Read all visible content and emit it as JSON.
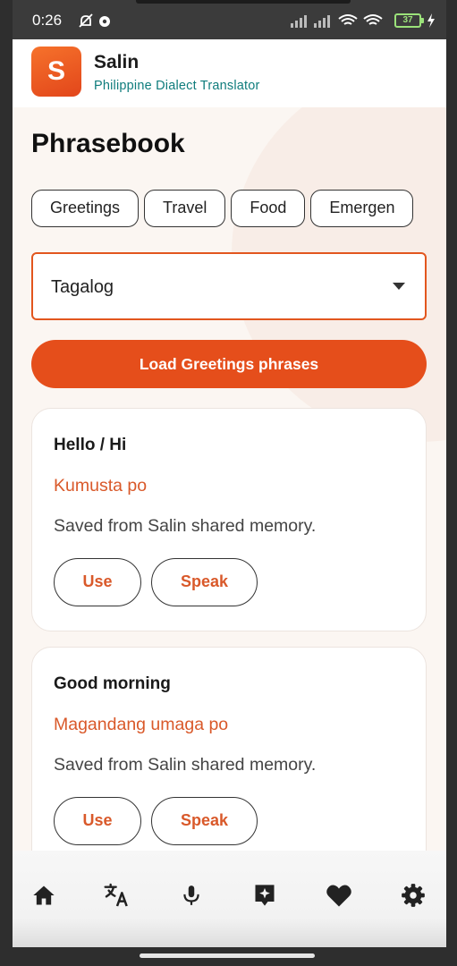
{
  "status_bar": {
    "time": "0:26",
    "battery": "37"
  },
  "app": {
    "name": "Salin",
    "tagline": "Philippine Dialect Translator",
    "logo_letter": "S"
  },
  "page": {
    "title": "Phrasebook"
  },
  "categories": [
    "Greetings",
    "Travel",
    "Food",
    "Emergen"
  ],
  "dialect_select": {
    "value": "Tagalog"
  },
  "load_button": {
    "label": "Load Greetings phrases"
  },
  "phrases": [
    {
      "english": "Hello / Hi",
      "translation": "Kumusta po",
      "note": "Saved from Salin shared memory.",
      "use_label": "Use",
      "speak_label": "Speak"
    },
    {
      "english": "Good morning",
      "translation": "Magandang umaga po",
      "note": "Saved from Salin shared memory.",
      "use_label": "Use",
      "speak_label": "Speak"
    }
  ],
  "bottom_nav": [
    "home-icon",
    "translate-icon",
    "microphone-icon",
    "phrasebook-icon",
    "favorites-icon",
    "settings-icon"
  ],
  "colors": {
    "accent": "#e54e1b",
    "translation_text": "#d9592a",
    "tagline": "#0f7c7c"
  }
}
